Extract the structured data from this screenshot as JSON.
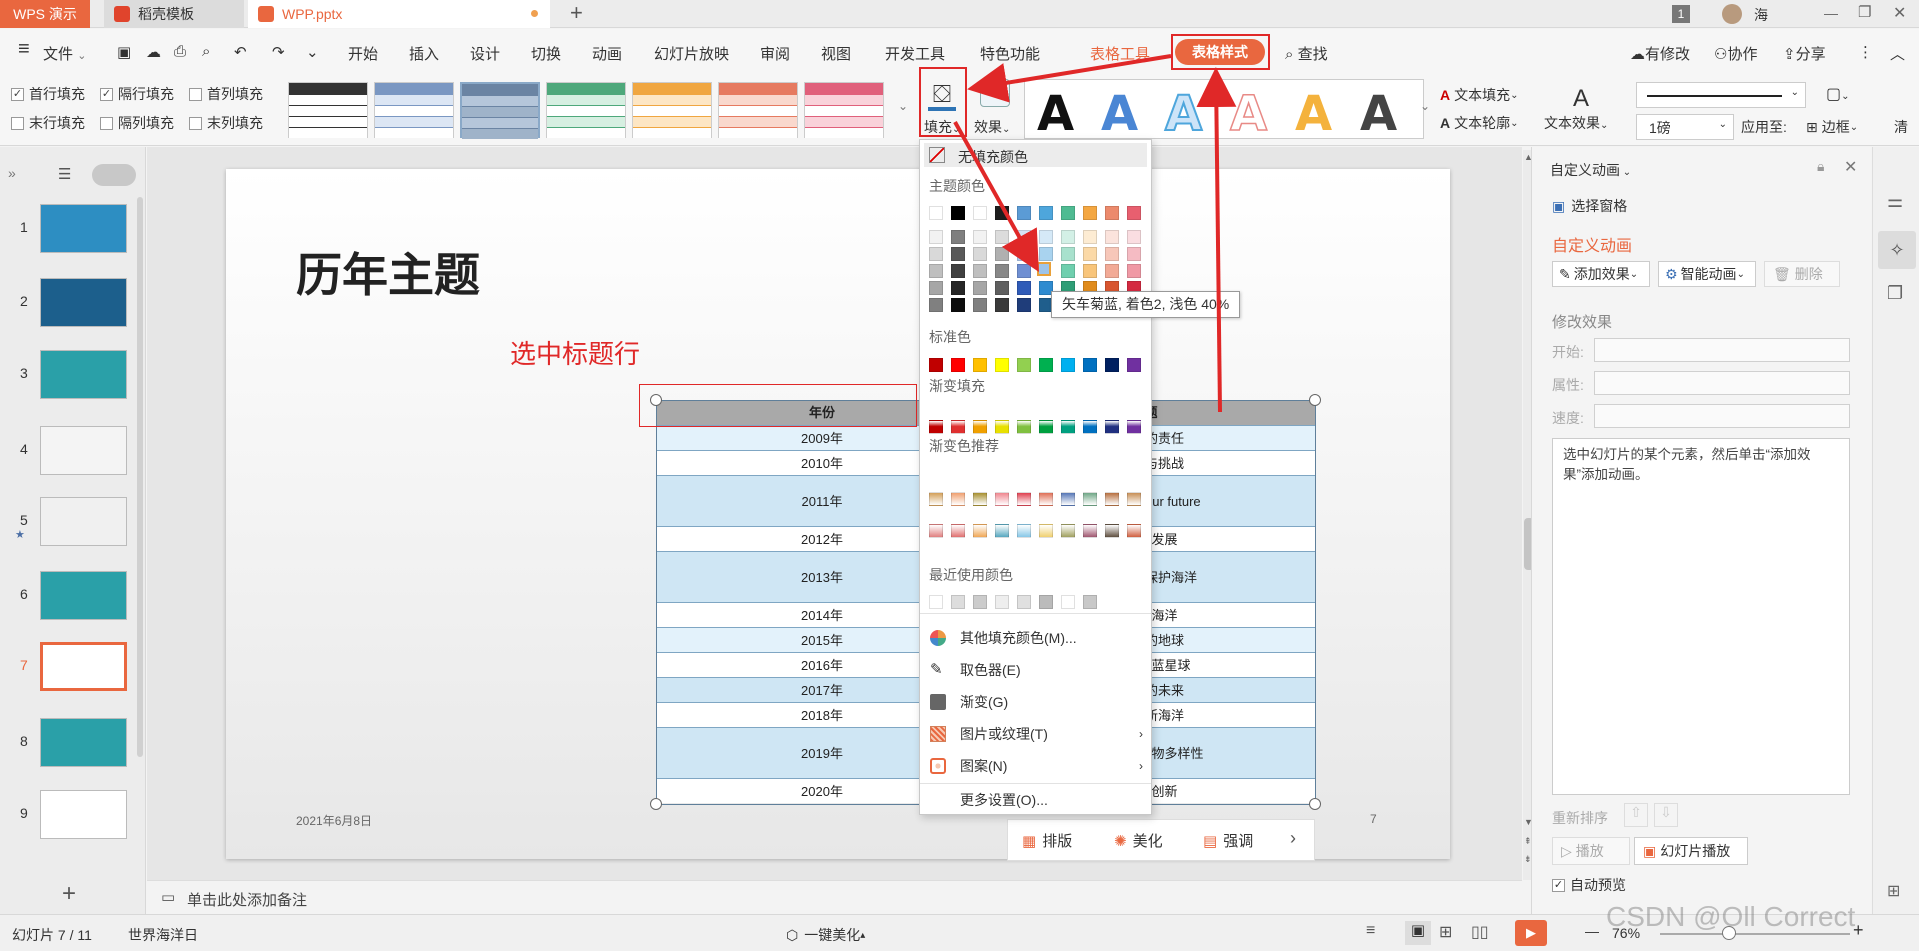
{
  "tabs": {
    "app": "WPS 演示",
    "template": "稻壳模板",
    "file": "WPP.pptx",
    "new_tab": "+",
    "badge": "1",
    "user": "海"
  },
  "menu": {
    "hamburger": "≡",
    "file": "文件",
    "items": [
      "开始",
      "插入",
      "设计",
      "切换",
      "动画",
      "幻灯片放映",
      "审阅",
      "视图",
      "开发工具",
      "特色功能"
    ],
    "table_tools": "表格工具",
    "table_style": "表格样式",
    "search": "查找",
    "revision": "有修改",
    "collab": "协作",
    "share": "分享"
  },
  "ribbon": {
    "checks": [
      {
        "label": "首行填充",
        "checked": true
      },
      {
        "label": "隔行填充",
        "checked": true
      },
      {
        "label": "首列填充",
        "checked": false
      },
      {
        "label": "末行填充",
        "checked": false
      },
      {
        "label": "隔列填充",
        "checked": false
      },
      {
        "label": "末列填充",
        "checked": false
      }
    ],
    "fill_label": "填充",
    "effect_label": "效果",
    "text_a": "A",
    "text_fill": "文本填充",
    "text_outline": "文本轮廓",
    "text_effect": "文本效果",
    "line_weight": "1磅",
    "apply_to": "应用至:",
    "border": "边框",
    "clear": "清"
  },
  "slides": {
    "numbers": [
      "1",
      "2",
      "3",
      "4",
      "5",
      "6",
      "7",
      "8",
      "9"
    ],
    "active": "7",
    "add": "+"
  },
  "slide": {
    "title": "历年主题",
    "annotation": "选中标题行",
    "date": "2021年6月8日",
    "page_number": "7",
    "table_header": [
      "年份",
      "主题"
    ],
    "table_rows": [
      [
        "2009年",
        "我们的责任"
      ],
      [
        "2010年",
        "机遇与挑战"
      ],
      [
        "2011年",
        "Greening our future"
      ],
      [
        "2012年",
        "可持续发展"
      ],
      [
        "2013年",
        "我们有能力保护海洋"
      ],
      [
        "2014年",
        "保护海洋"
      ],
      [
        "2015年",
        "健康的地球"
      ],
      [
        "2016年",
        "守护蔚蓝星球"
      ],
      [
        "2017年",
        "我们的未来"
      ],
      [
        "2018年",
        "扬帆新海洋"
      ],
      [
        "2019年",
        "保护海洋生物多样性"
      ],
      [
        "2020年",
        "海洋创新"
      ]
    ],
    "table_header_visible": [
      "年份",
      "题"
    ],
    "table_rows_visible": [
      [
        "2009年",
        "我们的责任"
      ],
      [
        "2010年",
        "机遇与挑战"
      ],
      [
        "2011年",
        "eening our future"
      ],
      [
        "2012年",
        "持续发展"
      ],
      [
        "2013年",
        "有能力保护海洋"
      ],
      [
        "2014年",
        "保护海洋"
      ],
      [
        "2015年",
        "健康的地球"
      ],
      [
        "2016年",
        "守护蔚蓝星球"
      ],
      [
        "2017年",
        "我们的未来"
      ],
      [
        "2018年",
        "扬帆新海洋"
      ],
      [
        "2019年",
        "护海洋生物多样性"
      ],
      [
        "2020年",
        "海洋创新"
      ]
    ],
    "float_toolbar": [
      "排版",
      "美化",
      "强调"
    ]
  },
  "dropdown": {
    "no_fill": "无填充颜色",
    "theme_colors": "主题颜色",
    "tooltip": "矢车菊蓝, 着色2, 浅色 40%",
    "standard_colors": "标准色",
    "gradient_fill": "渐变填充",
    "gradient_rec": "渐变色推荐",
    "recent": "最近使用颜色",
    "items": [
      "其他填充颜色(M)...",
      "取色器(E)",
      "渐变(G)",
      "图片或纹理(T)",
      "图案(N)",
      "更多设置(O)..."
    ],
    "theme_top": [
      "#ffffff",
      "#000000",
      "#ffffff",
      "#1e1e1e",
      "#5b9bd5",
      "#4ea6dc",
      "#4fbb92",
      "#f4a742",
      "#ec8a6c",
      "#e85f6f"
    ],
    "theme_cols": [
      [
        "#f2f2f2",
        "#d9d9d9",
        "#bfbfbf",
        "#a6a6a6",
        "#808080"
      ],
      [
        "#7f7f7f",
        "#595959",
        "#404040",
        "#262626",
        "#0d0d0d"
      ],
      [
        "#f2f2f2",
        "#d9d9d9",
        "#bfbfbf",
        "#a6a6a6",
        "#808080"
      ],
      [
        "#dcdcdc",
        "#b0b0b0",
        "#888888",
        "#5f5f5f",
        "#3a3a3a"
      ],
      [
        "#d6e3f6",
        "#adc6ec",
        "#6f8fd2",
        "#2f5bb8",
        "#1f3d7a"
      ],
      [
        "#d5e9f7",
        "#a9d3ef",
        "#7cbde8",
        "#2e8bd0",
        "#1f5e8c"
      ],
      [
        "#d3f0e6",
        "#a8e1cd",
        "#6fcfae",
        "#2e9e76",
        "#1f6a4f"
      ],
      [
        "#fdecd3",
        "#fbd9a7",
        "#f8c57b",
        "#e08b1b",
        "#965c12"
      ],
      [
        "#fbe3dc",
        "#f7c7b9",
        "#f2aa96",
        "#d8552f",
        "#902f1a"
      ],
      [
        "#fadde1",
        "#f5bbc3",
        "#f099a5",
        "#d42a41",
        "#8e1c2b"
      ]
    ],
    "standard": [
      "#c00000",
      "#ff0000",
      "#ffc000",
      "#ffff00",
      "#92d050",
      "#00b050",
      "#00b0f0",
      "#0070c0",
      "#002060",
      "#7030a0"
    ],
    "gradients": [
      "#c00000",
      "#e03030",
      "#f0a000",
      "#e8e000",
      "#80c040",
      "#00a040",
      "#00a080",
      "#0070c0",
      "#203080",
      "#7030a0"
    ],
    "gradrec1": [
      "#d4a05a",
      "#f0a070",
      "#a89030",
      "#f08890",
      "#e04050",
      "#e07058",
      "#5878b8",
      "#70a888",
      "#b87040",
      "#c89058"
    ],
    "gradrec2": [
      "#e08080",
      "#e07070",
      "#f0a858",
      "#58a8c0",
      "#88c8e8",
      "#f0d070",
      "#a0a060",
      "#a05870",
      "#605040",
      "#d06040"
    ],
    "recent_colors": [
      "#ffffff",
      "#dddddd",
      "#cccccc",
      "#eeeeee",
      "#e0e0e0",
      "#bbbbbb",
      "#ffffff",
      "#c8c8c8"
    ]
  },
  "rightpanel": {
    "title": "自定义动画",
    "select_pane": "选择窗格",
    "custom_anim": "自定义动画",
    "add_effect": "添加效果",
    "smart_anim": "智能动画",
    "delete": "删除",
    "modify_effect": "修改效果",
    "start": "开始:",
    "property": "属性:",
    "speed": "速度:",
    "hint": "选中幻灯片的某个元素，然后单击“添加效果”添加动画。",
    "reorder": "重新排序",
    "play": "播放",
    "slideshow": "幻灯片播放",
    "auto_preview": "自动预览"
  },
  "notes": {
    "placeholder": "单击此处添加备注"
  },
  "status": {
    "slide_info": "幻灯片 7 / 11",
    "theme": "世界海洋日",
    "beautify": "一键美化",
    "zoom": "76%",
    "watermark": "CSDN @Oll Correct"
  },
  "colors": {
    "accent": "#e9673f",
    "annotation": "#e02828",
    "header_gray": "#a9a9a9",
    "row_light": "#e3f2fb",
    "row_alt": "#ffffff"
  }
}
